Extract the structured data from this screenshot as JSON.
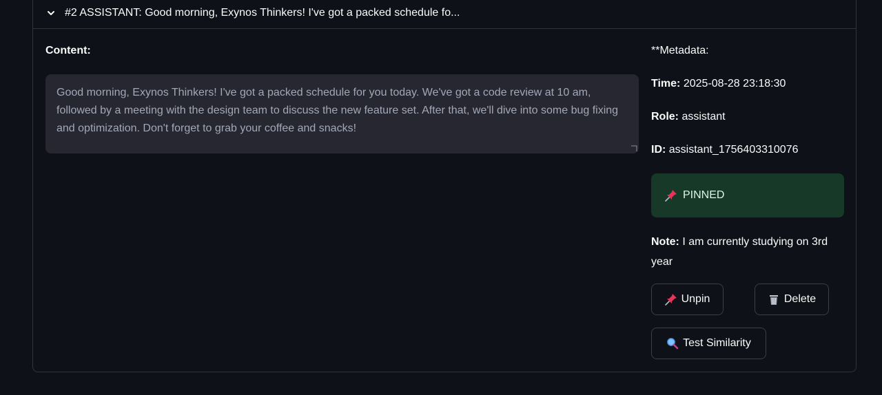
{
  "expander": {
    "title": "#2 ASSISTANT: Good morning, Exynos Thinkers! I've got a packed schedule fo...",
    "chevron_icon": "chevron-down-icon"
  },
  "content": {
    "label": "Content:",
    "text": "Good morning, Exynos Thinkers! I've got a packed schedule for you today. We've got a code review at 10 am, followed by a meeting with the design team to discuss the new feature set. After that, we'll dive into some bug fixing and optimization. Don't forget to grab your coffee and snacks!"
  },
  "metadata": {
    "heading": "**Metadata:",
    "time_label": "Time:",
    "time_value": "2025-08-28 23:18:30",
    "role_label": "Role:",
    "role_value": "assistant",
    "id_label": "ID:",
    "id_value": "assistant_1756403310076"
  },
  "pinned": {
    "label": "PINNED",
    "icon": "pushpin-icon"
  },
  "note": {
    "label": "Note:",
    "value": "I am currently studying on 3rd year"
  },
  "buttons": {
    "unpin": "Unpin",
    "delete": "Delete",
    "test_similarity": "Test Similarity"
  },
  "colors": {
    "background": "#0e1117",
    "textarea_bg": "#262730",
    "pinned_bg": "#173928",
    "border": "#31333f"
  }
}
